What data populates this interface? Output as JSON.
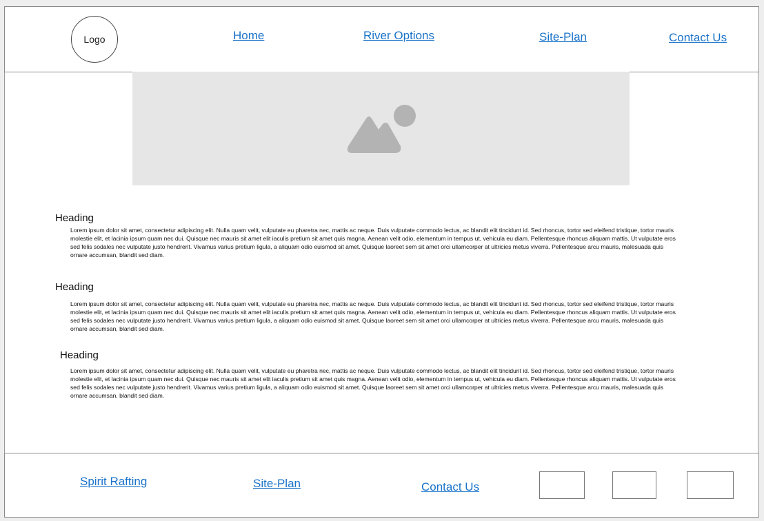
{
  "header": {
    "logo_text": "Logo",
    "nav": {
      "home": "Home",
      "river_options": "River Options",
      "site_plan": "Site-Plan",
      "contact_us": "Contact Us"
    }
  },
  "hero": {
    "icon": "image-placeholder-icon"
  },
  "sections": [
    {
      "heading": "Heading",
      "body": "Lorem ipsum dolor sit amet, consectetur adipiscing elit. Nulla quam velit, vulputate eu pharetra nec, mattis ac neque. Duis vulputate commodo lectus, ac blandit elit tincidunt id. Sed rhoncus, tortor sed eleifend tristique, tortor mauris molestie elit, et lacinia ipsum quam nec dui. Quisque nec mauris sit amet elit iaculis pretium sit amet quis magna. Aenean velit odio, elementum in tempus ut, vehicula eu diam. Pellentesque rhoncus aliquam mattis. Ut vulputate eros sed felis sodales nec vulputate justo hendrerit. Vivamus varius pretium ligula, a aliquam odio euismod sit amet. Quisque laoreet sem sit amet orci ullamcorper at ultricies metus viverra. Pellentesque arcu mauris, malesuada quis ornare accumsan, blandit sed diam."
    },
    {
      "heading": "Heading",
      "body": "Lorem ipsum dolor sit amet, consectetur adipiscing elit. Nulla quam velit, vulputate eu pharetra nec, mattis ac neque. Duis vulputate commodo lectus, ac blandit elit tincidunt id. Sed rhoncus, tortor sed eleifend tristique, tortor mauris molestie elit, et lacinia ipsum quam nec dui. Quisque nec mauris sit amet elit iaculis pretium sit amet quis magna. Aenean velit odio, elementum in tempus ut, vehicula eu diam. Pellentesque rhoncus aliquam mattis. Ut vulputate eros sed felis sodales nec vulputate justo hendrerit. Vivamus varius pretium ligula, a aliquam odio euismod sit amet. Quisque laoreet sem sit amet orci ullamcorper at ultricies metus viverra. Pellentesque arcu mauris, malesuada quis ornare accumsan, blandit sed diam."
    },
    {
      "heading": "Heading",
      "body": "Lorem ipsum dolor sit amet, consectetur adipiscing elit. Nulla quam velit, vulputate eu pharetra nec, mattis ac neque. Duis vulputate commodo lectus, ac blandit elit tincidunt id. Sed rhoncus, tortor sed eleifend tristique, tortor mauris molestie elit, et lacinia ipsum quam nec dui. Quisque nec mauris sit amet elit iaculis pretium sit amet quis magna. Aenean velit odio, elementum in tempus ut, vehicula eu diam. Pellentesque rhoncus aliquam mattis. Ut vulputate eros sed felis sodales nec vulputate justo hendrerit. Vivamus varius pretium ligula, a aliquam odio euismod sit amet. Quisque laoreet sem sit amet orci ullamcorper at ultricies metus viverra. Pellentesque arcu mauris, malesuada quis ornare accumsan, blandit sed diam."
    }
  ],
  "footer": {
    "brand": "Spirit Rafting",
    "site_plan": "Site-Plan",
    "contact_us": "Contact Us"
  },
  "colors": {
    "link": "#1a73c9",
    "placeholder_bg": "#e6e6e6",
    "placeholder_icon": "#b3b3b3"
  }
}
